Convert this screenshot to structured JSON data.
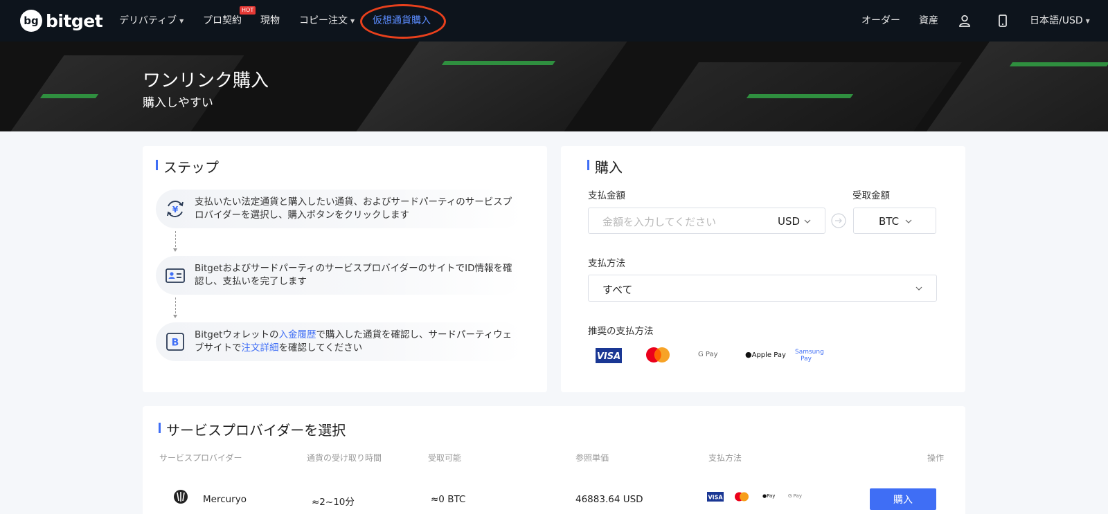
{
  "brand": {
    "name": "bitget",
    "mark": "bg"
  },
  "nav": {
    "derivatives": "デリバティブ",
    "pro": "プロ契約",
    "hot": "HOT",
    "spot": "現物",
    "copy": "コピー注文",
    "buy_crypto": "仮想通貨購入",
    "orders": "オーダー",
    "assets": "資産",
    "language": "日本語/USD"
  },
  "banner": {
    "title": "ワンリンク購入",
    "subtitle": "購入しやすい"
  },
  "steps": {
    "title": "ステップ",
    "step1": "支払いたい法定通貨と購入したい通貨、およびサードパーティのサービスプロバイダーを選択し、購入ボタンをクリックします",
    "step2": "BitgetおよびサードパーティのサービスプロバイダーのサイトでID情報を確認し、支払いを完了します",
    "step3_a": "Bitgetウォレットの",
    "step3_link1": "入金履歴",
    "step3_b": "で購入した通貨を確認し、サードパーティウェブサイトで",
    "step3_link2": "注文詳細",
    "step3_c": "を確認してください"
  },
  "buy": {
    "title": "購入",
    "pay_amount_label": "支払金額",
    "receive_amount_label": "受取金額",
    "amount_placeholder": "金額を入力してください",
    "fiat": "USD",
    "crypto": "BTC",
    "pay_method_label": "支払方法",
    "pay_method_value": "すべて",
    "recommended_label": "推奨の支払方法",
    "methods": [
      "VISA",
      "Mastercard",
      "G Pay",
      "Apple Pay",
      "Samsung Pay"
    ]
  },
  "providers": {
    "title": "サービスプロバイダーを選択",
    "columns": [
      "サービスプロバイダー",
      "通貨の受け取り時間",
      "受取可能",
      "参照単価",
      "支払方法",
      "操作"
    ],
    "rows": [
      {
        "name": "Mercuryo",
        "time": "≈2~10分",
        "receivable": "≈0 BTC",
        "price": "46883.64 USD",
        "action": "購入"
      }
    ]
  }
}
